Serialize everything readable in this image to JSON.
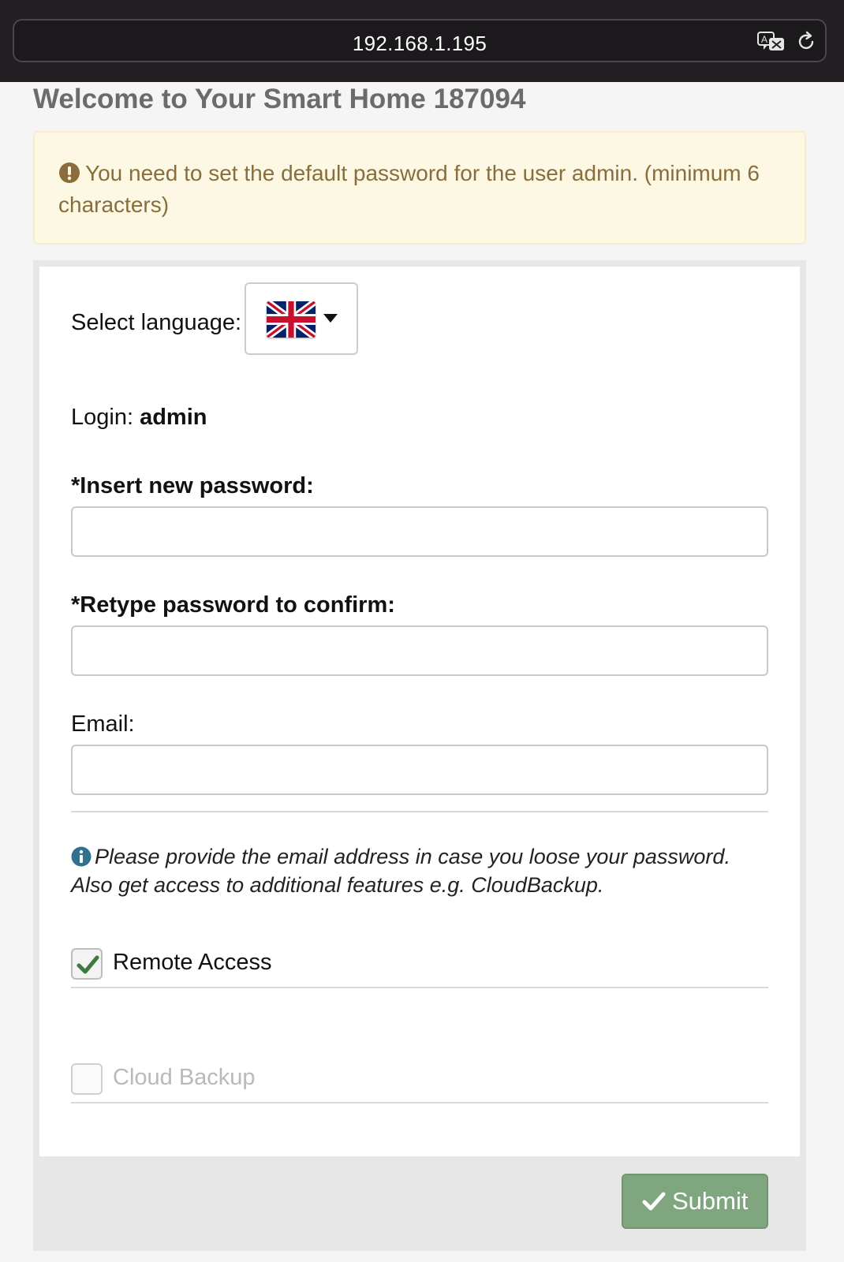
{
  "browser": {
    "url": "192.168.1.195",
    "icons": [
      "translate-icon",
      "reload-icon"
    ]
  },
  "page": {
    "title": "Welcome to Your Smart Home 187094"
  },
  "alert": {
    "icon": "exclamation-circle-icon",
    "message": "You need to set the default password for the user admin. (minimum 6 characters)",
    "colors": {
      "text": "#8a6d3b",
      "background": "#fcf8e3",
      "border": "#faebcc"
    }
  },
  "form": {
    "language": {
      "label": "Select language:",
      "selected": "English (UK flag)",
      "icon": "uk-flag-icon"
    },
    "login": {
      "label": "Login:",
      "value": "admin"
    },
    "new_password": {
      "label": "*Insert new password:",
      "value": ""
    },
    "confirm_password": {
      "label": "*Retype password to confirm:",
      "value": ""
    },
    "email": {
      "label": "Email:",
      "value": ""
    },
    "email_info": {
      "icon": "info-circle-icon",
      "text": "Please provide the email address in case you loose your password. Also get access to additional features e.g. CloudBackup."
    },
    "remote_access": {
      "label": "Remote Access",
      "checked": true
    },
    "cloud_backup": {
      "label": "Cloud Backup",
      "checked": false,
      "disabled": true
    },
    "submit": {
      "label": "Submit",
      "icon": "check-icon",
      "color": "#7fa67f"
    }
  }
}
